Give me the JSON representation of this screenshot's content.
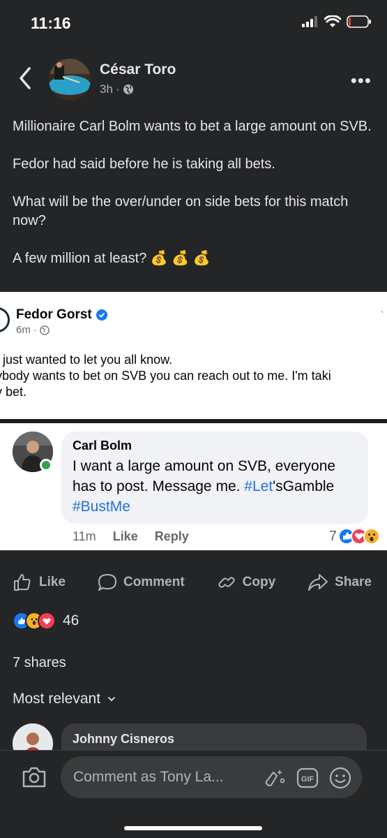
{
  "status_bar": {
    "time": "11:16"
  },
  "post": {
    "author": "César Toro",
    "time": "3h",
    "paragraphs": [
      "Millionaire Carl Bolm wants to bet a large amount on SVB.",
      "Fedor had said before he is taking all bets.",
      "What will be the over/under on side bets for this match now?",
      "A few million at least?"
    ],
    "emoji": "💰 💰 💰"
  },
  "embed_post": {
    "author": "Fedor Gorst",
    "time": "6m",
    "lines": [
      ", just wanted to let you all know.",
      "ybody wants to bet on SVB you can reach out to me. I'm taki",
      "y bet."
    ]
  },
  "embed_comment": {
    "author": "Carl Bolm",
    "text_part1": "I want a large amount on SVB, everyone has to post. Message me. ",
    "hashtag1_a": "#Let",
    "hashtag1_b": "'sGamble",
    "hashtag2": "#BustMe",
    "time": "11m",
    "like_label": "Like",
    "reply_label": "Reply",
    "reaction_count": "7"
  },
  "actions": {
    "like": "Like",
    "comment": "Comment",
    "copy": "Copy",
    "share": "Share"
  },
  "stats": {
    "reactions": "46",
    "shares": "7 shares"
  },
  "comments": {
    "sort_label": "Most relevant",
    "first_author": "Johnny Cisneros"
  },
  "composer": {
    "placeholder": "Comment as Tony La..."
  },
  "colors": {
    "background": "#242526",
    "like_blue": "#1877f2",
    "love_red": "#f33e58",
    "hashtag": "#216fdb"
  }
}
